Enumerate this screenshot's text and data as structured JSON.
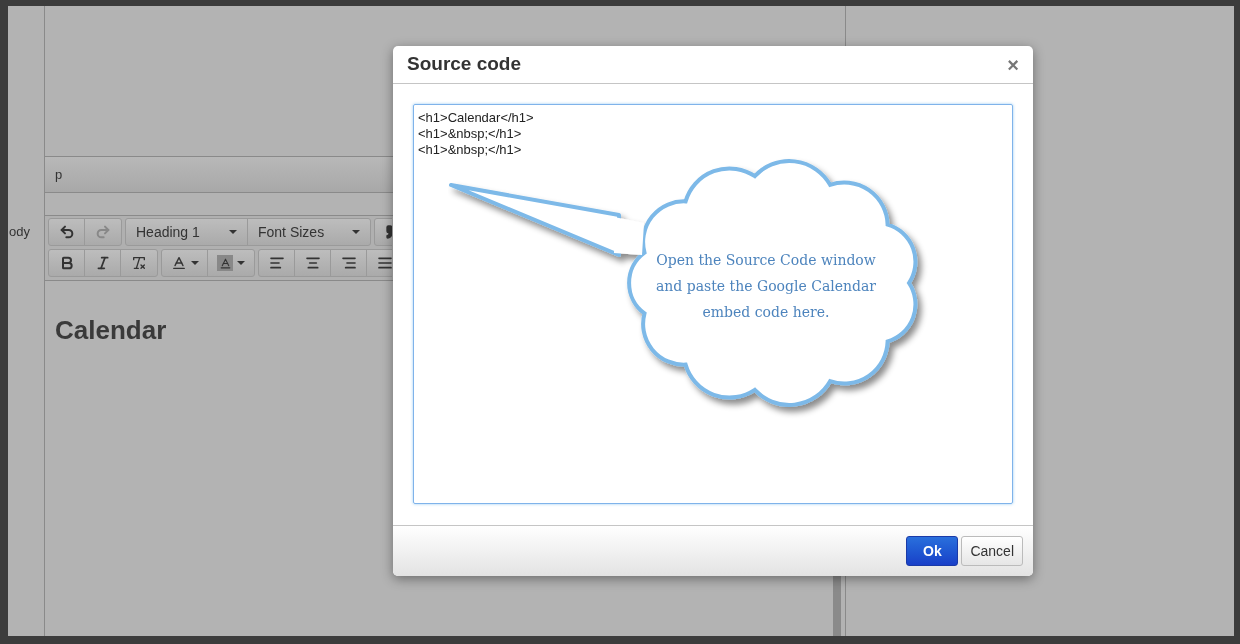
{
  "sidebar_label": "ody",
  "status_bar": {
    "path": "p"
  },
  "toolbar": {
    "undo": {
      "disabled": false
    },
    "redo": {
      "disabled": true
    },
    "dropdowns": [
      {
        "label": "Heading 1"
      },
      {
        "label": "Font Sizes"
      }
    ]
  },
  "editor": {
    "heading": "Calendar"
  },
  "dialog": {
    "title": "Source code",
    "close": "×",
    "code_lines": [
      "<h1>Calendar</h1>",
      "<h1>&nbsp;</h1>",
      "<h1>&nbsp;</h1>"
    ],
    "callout": "Open the Source Code window and paste the Google Calendar embed code here.",
    "buttons": [
      {
        "label": "Ok",
        "kind": "primary"
      },
      {
        "label": "Cancel",
        "kind": "default"
      }
    ]
  }
}
